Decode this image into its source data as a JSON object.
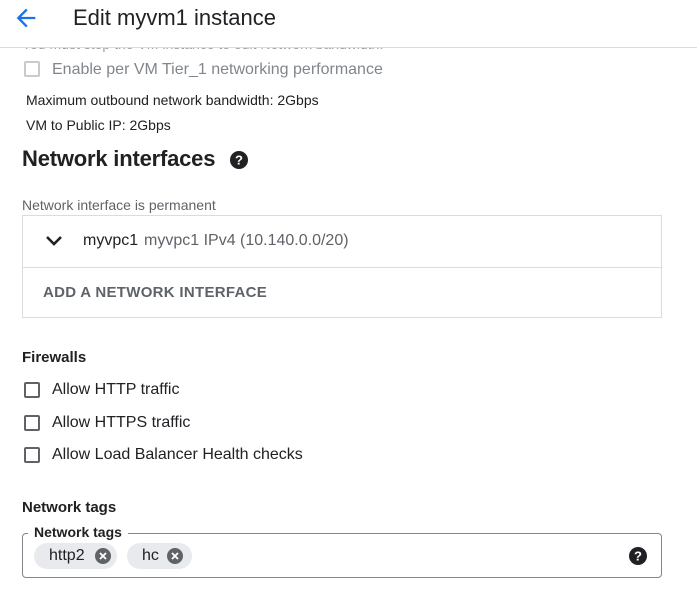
{
  "header": {
    "title": "Edit myvm1 instance"
  },
  "bandwidth": {
    "clipped_note": "You must stop the VM instance to edit Network bandwidth.",
    "tier1_label": "Enable per VM Tier_1 networking performance",
    "max_outbound": "Maximum outbound network bandwidth: 2Gbps",
    "vm_to_public": "VM to Public IP: 2Gbps"
  },
  "network_interfaces": {
    "title": "Network interfaces",
    "permanent_note": "Network interface is permanent",
    "items": [
      {
        "name": "myvpc1",
        "detail": "myvpc1 IPv4 (10.140.0.0/20)"
      }
    ],
    "add_label": "ADD A NETWORK INTERFACE"
  },
  "firewalls": {
    "title": "Firewalls",
    "options": [
      {
        "label": "Allow HTTP traffic",
        "checked": false
      },
      {
        "label": "Allow HTTPS traffic",
        "checked": false
      },
      {
        "label": "Allow Load Balancer Health checks",
        "checked": false
      }
    ]
  },
  "network_tags": {
    "title": "Network tags",
    "field_label": "Network tags",
    "tags": [
      "http2",
      "hc"
    ]
  },
  "colors": {
    "accent": "#1a73e8",
    "text": "#202124",
    "muted": "#5f6368",
    "border": "#dadce0"
  },
  "icons": {
    "back": "arrow-back-icon",
    "help": "help-circle-icon",
    "expand": "chevron-down-icon",
    "remove": "cancel-circle-icon"
  }
}
